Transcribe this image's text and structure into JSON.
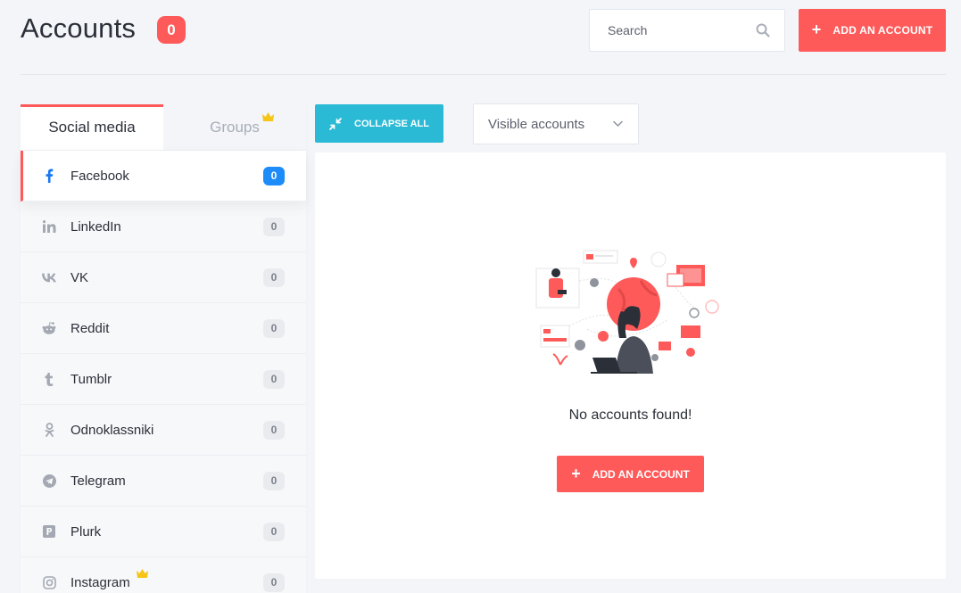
{
  "header": {
    "title": "Accounts",
    "count_badge": "0",
    "search": {
      "placeholder": "Search"
    },
    "add_button_label": "ADD AN ACCOUNT"
  },
  "sidebar": {
    "tabs": [
      {
        "label": "Social media",
        "active": true
      },
      {
        "label": "Groups",
        "active": false,
        "premium_icon": "crown-icon"
      }
    ],
    "items": [
      {
        "label": "Facebook",
        "count": "0",
        "icon": "facebook-icon",
        "active": true
      },
      {
        "label": "LinkedIn",
        "count": "0",
        "icon": "linkedin-icon"
      },
      {
        "label": "VK",
        "count": "0",
        "icon": "vk-icon"
      },
      {
        "label": "Reddit",
        "count": "0",
        "icon": "reddit-icon"
      },
      {
        "label": "Tumblr",
        "count": "0",
        "icon": "tumblr-icon"
      },
      {
        "label": "Odnoklassniki",
        "count": "0",
        "icon": "odnoklassniki-icon"
      },
      {
        "label": "Telegram",
        "count": "0",
        "icon": "telegram-icon"
      },
      {
        "label": "Plurk",
        "count": "0",
        "icon": "plurk-icon"
      },
      {
        "label": "Instagram",
        "count": "0",
        "icon": "instagram-icon",
        "premium_icon": "crown-icon"
      }
    ]
  },
  "toolbar": {
    "collapse_label": "COLLAPSE ALL",
    "visible_select_value": "Visible accounts"
  },
  "main": {
    "empty_message": "No accounts found!",
    "add_button_label": "ADD AN ACCOUNT"
  },
  "colors": {
    "accent_red": "#fe5a5a",
    "accent_cyan": "#2bbad6",
    "badge_blue": "#1d8cf8",
    "crown_yellow": "#f5c518"
  }
}
